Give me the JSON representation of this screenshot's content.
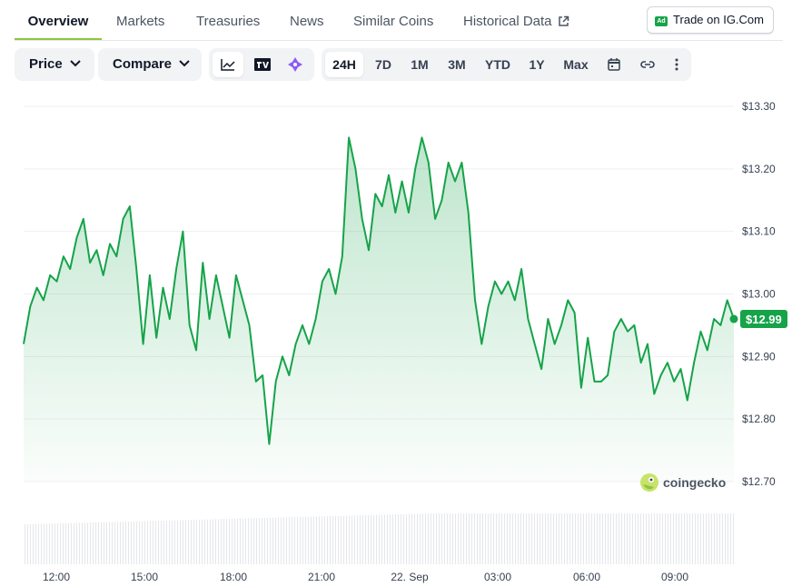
{
  "tabs": [
    {
      "label": "Overview",
      "active": true
    },
    {
      "label": "Markets"
    },
    {
      "label": "Treasuries"
    },
    {
      "label": "News"
    },
    {
      "label": "Similar Coins"
    },
    {
      "label": "Historical Data"
    }
  ],
  "trade": {
    "label": "Trade on IG.Com",
    "badge": "Ad"
  },
  "toolbar": {
    "price_label": "Price",
    "compare_label": "Compare",
    "chart_types": [
      "line-chart-icon",
      "tradingview-icon",
      "sparkle-icon"
    ],
    "ranges": [
      "24H",
      "7D",
      "1M",
      "3M",
      "YTD",
      "1Y",
      "Max"
    ],
    "active_range": "24H",
    "extra_icons": [
      "calendar-icon",
      "link-icon",
      "more-icon"
    ]
  },
  "watermark": "coingecko",
  "colors": {
    "line": "#16a34a",
    "accent": "#8dc63f",
    "volume": "#e5e7eb"
  },
  "chart_data": {
    "type": "line",
    "ylim": [
      12.7,
      13.3
    ],
    "y_ticks": [
      "$13.30",
      "$13.20",
      "$13.10",
      "$13.00",
      "$12.90",
      "$12.80",
      "$12.70"
    ],
    "x_ticks": [
      "12:00",
      "15:00",
      "18:00",
      "21:00",
      "22. Sep",
      "03:00",
      "06:00",
      "09:00"
    ],
    "last_price_label": "$12.99",
    "series": [
      {
        "values": [
          12.92,
          12.98,
          13.01,
          12.99,
          13.03,
          13.02,
          13.06,
          13.04,
          13.09,
          13.12,
          13.05,
          13.07,
          13.03,
          13.08,
          13.06,
          13.12,
          13.14,
          13.04,
          12.92,
          13.03,
          12.93,
          13.01,
          12.96,
          13.04,
          13.1,
          12.95,
          12.91,
          13.05,
          12.96,
          13.03,
          12.98,
          12.93,
          13.03,
          12.99,
          12.95,
          12.86,
          12.87,
          12.76,
          12.86,
          12.9,
          12.87,
          12.92,
          12.95,
          12.92,
          12.96,
          13.02,
          13.04,
          13.0,
          13.06,
          13.25,
          13.2,
          13.12,
          13.07,
          13.16,
          13.14,
          13.19,
          13.13,
          13.18,
          13.13,
          13.2,
          13.25,
          13.21,
          13.12,
          13.15,
          13.21,
          13.18,
          13.21,
          13.13,
          12.99,
          12.92,
          12.98,
          13.02,
          13.0,
          13.02,
          12.99,
          13.04,
          12.96,
          12.92,
          12.88,
          12.96,
          12.92,
          12.95,
          12.99,
          12.97,
          12.85,
          12.93,
          12.86,
          12.86,
          12.87,
          12.94,
          12.96,
          12.94,
          12.95,
          12.89,
          12.92,
          12.84,
          12.87,
          12.89,
          12.86,
          12.88,
          12.83,
          12.89,
          12.94,
          12.91,
          12.96,
          12.95,
          12.99,
          12.96
        ]
      }
    ]
  }
}
